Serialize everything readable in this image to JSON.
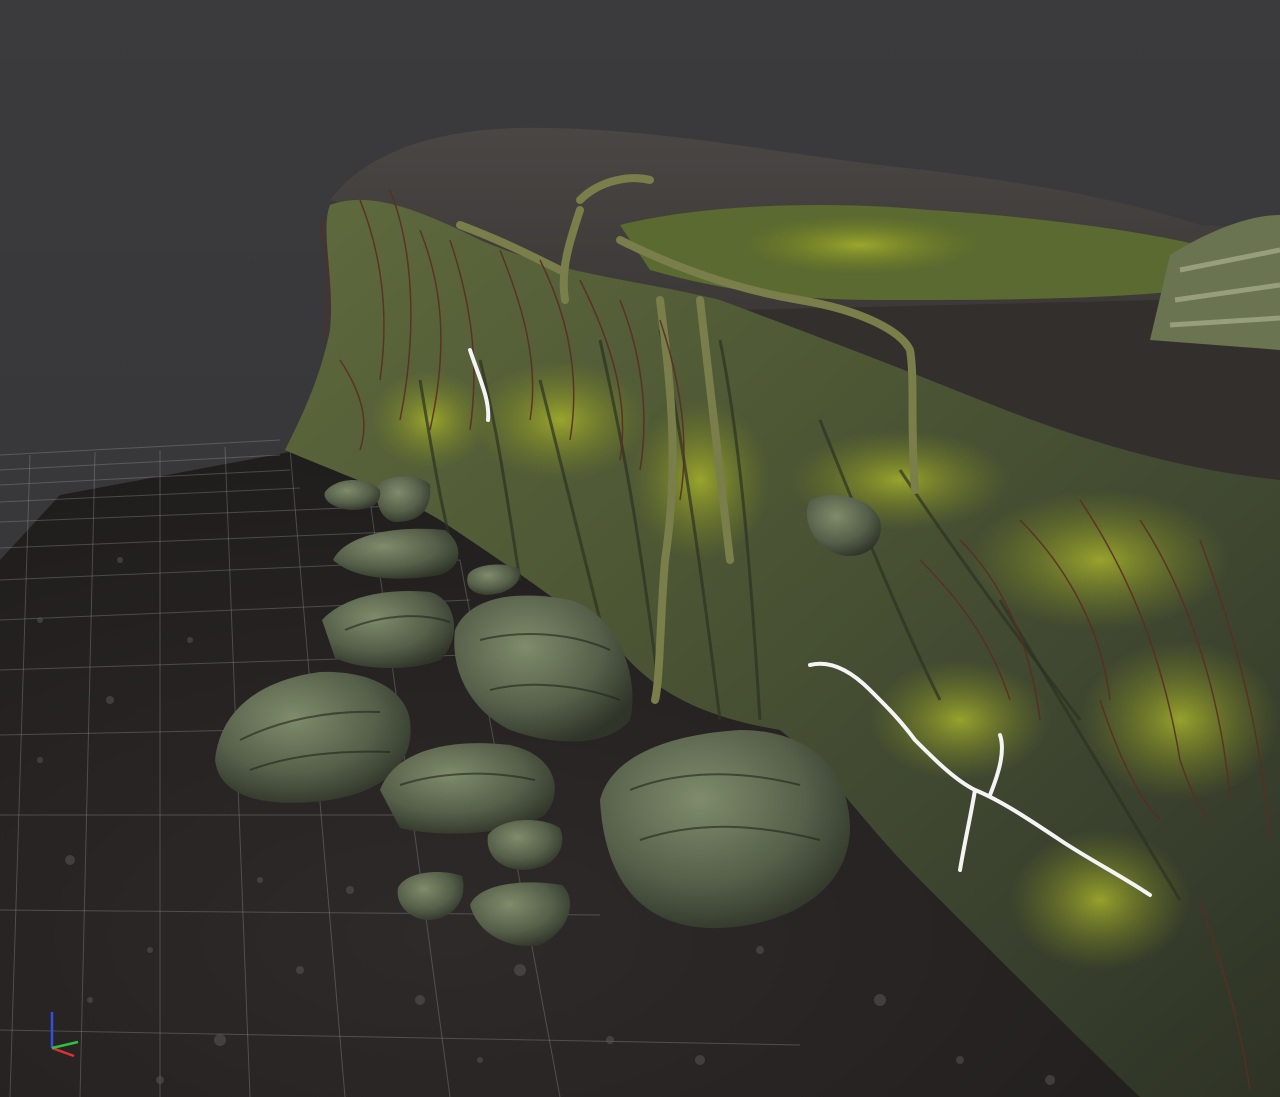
{
  "viewport": {
    "background_color": "#3a3a3c",
    "grid_color": "#9a9a9a",
    "ground_color": "#2a2626",
    "rock_color": "#4f5a3c",
    "moss_color": "#8a9a2a",
    "root_color": "#5a2e22",
    "crack_color": "#f4f4f4"
  },
  "axis_gizmo": {
    "x_color": "#e03030",
    "y_color": "#30c040",
    "z_color": "#3050e0"
  }
}
